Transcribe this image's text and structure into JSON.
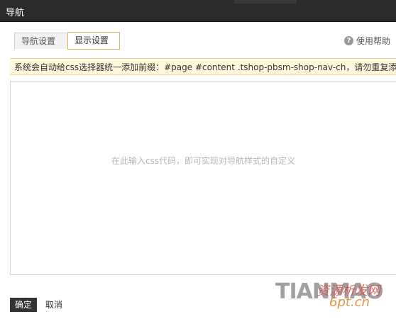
{
  "window": {
    "title": "导航"
  },
  "tabs": [
    {
      "label": "导航设置",
      "active": false
    },
    {
      "label": "显示设置",
      "active": true
    }
  ],
  "help": {
    "icon": "question-circle-icon",
    "label": "使用帮助"
  },
  "notice": {
    "text": "系统会自动给css选择器统一添加前缀：#page #content .tshop-pbsm-shop-nav-ch，请勿重复添加!"
  },
  "editor": {
    "value": "",
    "placeholder": "在此输入css代码，即可实现对导航样式的自定义"
  },
  "footer": {
    "ok_label": "确定",
    "cancel_label": "取消"
  },
  "watermark": {
    "latin": "TIANMAO",
    "cjk": "资源析发网",
    "url": "6pt.cn"
  },
  "colors": {
    "titlebar_bg": "#2b2b2b",
    "active_tab_border": "#e0b65c",
    "notice_bg": "#fff8dc",
    "ok_button_bg": "#333333"
  }
}
